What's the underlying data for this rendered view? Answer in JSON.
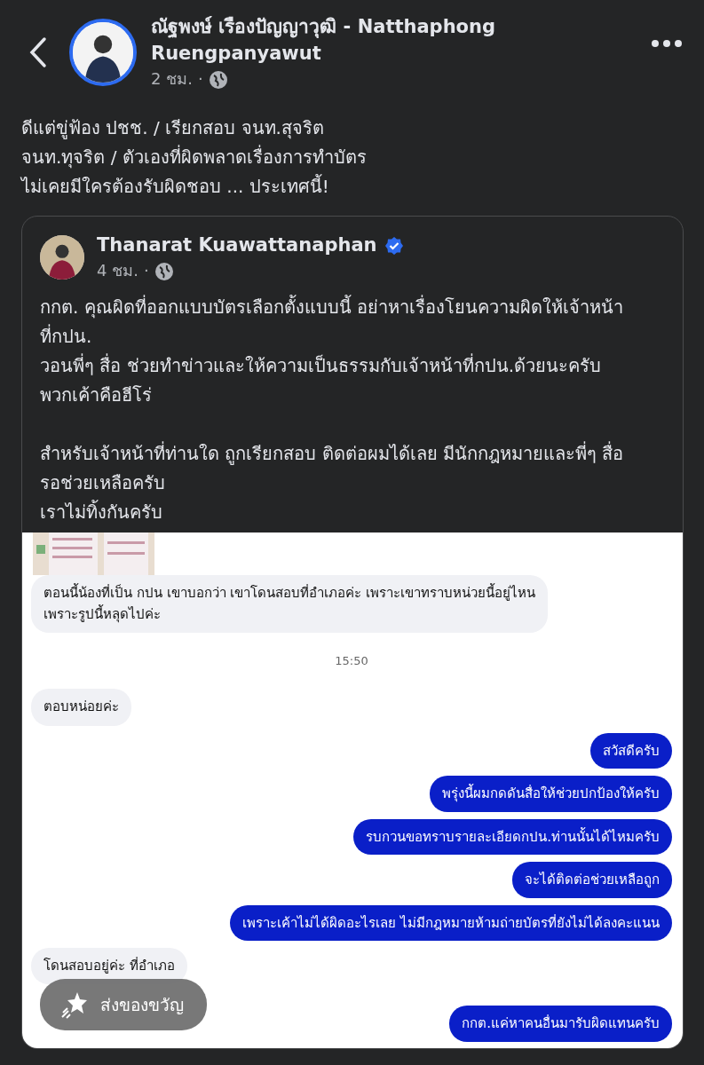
{
  "header": {
    "author": "ณัฐพงษ์ เรืองปัญญาวุฒิ - Natthaphong Ruengpanyawut",
    "time": "2 ชม.",
    "separator": "·"
  },
  "post_text": [
    "ดีแต่ขู่ฟ้อง ปชช. / เรียกสอบ จนท.สุจริต",
    "จนท.ทุจริต / ตัวเองที่ผิดพลาดเรื่องการทำบัตร",
    "ไม่เคยมีใครต้องรับผิดชอบ ... ประเทศนี้!"
  ],
  "shared_post": {
    "author": "Thanarat Kuawattanaphan",
    "verified": true,
    "time": "4 ชม.",
    "separator": "·",
    "paragraphs": [
      [
        "กกต. คุณผิดที่ออกแบบบัตรเลือกตั้งแบบนี้ อย่าหาเรื่องโยนความผิดให้เจ้าหน้าที่กปน.",
        "วอนพี่ๆ สื่อ ช่วยทำข่าวและให้ความเป็นธรรมกับเจ้าหน้าที่กปน.ด้วยนะครับ พวกเค้าคือฮีโร่"
      ],
      [
        "สำหรับเจ้าหน้าที่ท่านใด ถูกเรียกสอบ ติดต่อผมได้เลย มีนักกฎหมายและพี่ๆ สื่อรอช่วยเหลือครับ",
        "เราไม่ทิ้งกันครับ"
      ]
    ],
    "chat": [
      {
        "kind": "picture"
      },
      {
        "kind": "incoming",
        "text": "ตอนนี้น้องที่เป็น กปน เขาบอกว่า เขาโดนสอบที่อำเภอค่ะ เพราะเขาทราบหน่วยนี้อยู่ไหน\nเพราะรูปนี้หลุดไปค่ะ"
      },
      {
        "kind": "time",
        "text": "15:50"
      },
      {
        "kind": "incoming",
        "text": "ตอบหน่อยค่ะ"
      },
      {
        "kind": "outgoing",
        "text": "สวัสดีครับ"
      },
      {
        "kind": "outgoing",
        "text": "พรุ่งนี้ผมกดดันสื่อให้ช่วยปกป้องให้ครับ"
      },
      {
        "kind": "outgoing",
        "text": "รบกวนขอทราบรายละเอียดกปน.ท่านนั้นได้ไหมครับ"
      },
      {
        "kind": "outgoing",
        "text": "จะได้ติดต่อช่วยเหลือถูก"
      },
      {
        "kind": "outgoing",
        "text": "เพราะเค้าไม่ได้ผิดอะไรเลย ไม่มีกฎหมายห้ามถ่ายบัตรที่ยังไม่ได้ลงคะแนน"
      },
      {
        "kind": "incoming",
        "text": "โดนสอบอยู่ค่ะ ที่อำเภอ"
      },
      {
        "kind": "outgoing",
        "text": "กกต.แค่หาคนอื่นมารับผิดแทนครับ"
      }
    ]
  },
  "gift_button": {
    "label": "ส่งของขวัญ"
  }
}
